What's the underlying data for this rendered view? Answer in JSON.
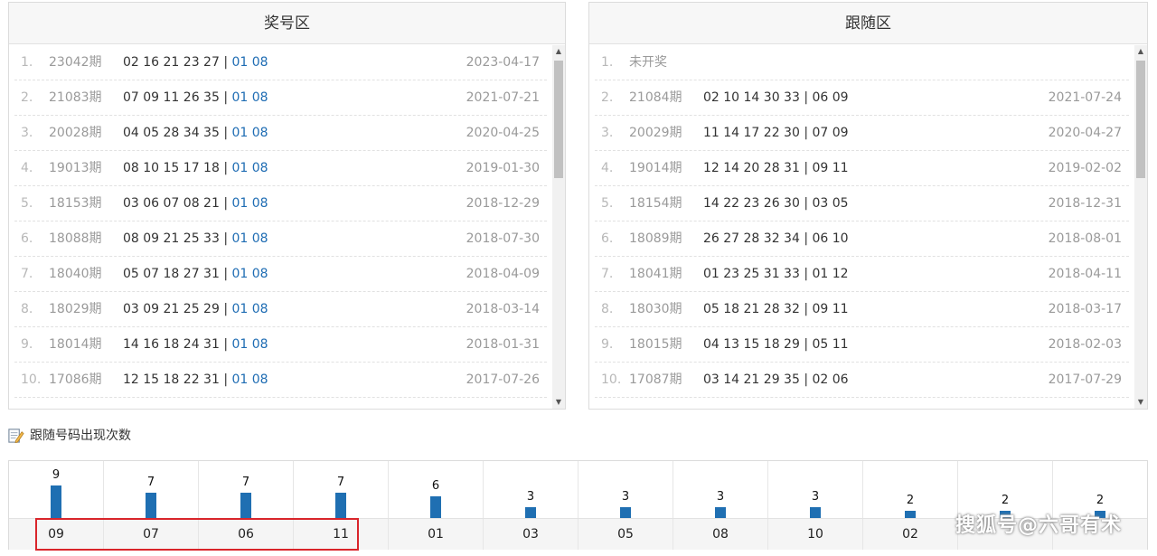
{
  "left_panel": {
    "title": "奖号区",
    "rows": [
      {
        "idx": "1.",
        "issue": "23042期",
        "front": "02 16 21 23 27 | ",
        "back": "01 08",
        "date": "2023-04-17"
      },
      {
        "idx": "2.",
        "issue": "21083期",
        "front": "07 09 11 26 35 | ",
        "back": "01 08",
        "date": "2021-07-21"
      },
      {
        "idx": "3.",
        "issue": "20028期",
        "front": "04 05 28 34 35 | ",
        "back": "01 08",
        "date": "2020-04-25"
      },
      {
        "idx": "4.",
        "issue": "19013期",
        "front": "08 10 15 17 18 | ",
        "back": "01 08",
        "date": "2019-01-30"
      },
      {
        "idx": "5.",
        "issue": "18153期",
        "front": "03 06 07 08 21 | ",
        "back": "01 08",
        "date": "2018-12-29"
      },
      {
        "idx": "6.",
        "issue": "18088期",
        "front": "08 09 21 25 33 | ",
        "back": "01 08",
        "date": "2018-07-30"
      },
      {
        "idx": "7.",
        "issue": "18040期",
        "front": "05 07 18 27 31 | ",
        "back": "01 08",
        "date": "2018-04-09"
      },
      {
        "idx": "8.",
        "issue": "18029期",
        "front": "03 09 21 25 29 | ",
        "back": "01 08",
        "date": "2018-03-14"
      },
      {
        "idx": "9.",
        "issue": "18014期",
        "front": "14 16 18 24 31 | ",
        "back": "01 08",
        "date": "2018-01-31"
      },
      {
        "idx": "10.",
        "issue": "17086期",
        "front": "12 15 18 22 31 | ",
        "back": "01 08",
        "date": "2017-07-26"
      }
    ]
  },
  "right_panel": {
    "title": "跟随区",
    "rows": [
      {
        "idx": "1.",
        "issue": "未开奖",
        "nums": "",
        "date": ""
      },
      {
        "idx": "2.",
        "issue": "21084期",
        "nums": "02 10 14 30 33 | 06 09",
        "date": "2021-07-24"
      },
      {
        "idx": "3.",
        "issue": "20029期",
        "nums": "11 14 17 22 30 | 07 09",
        "date": "2020-04-27"
      },
      {
        "idx": "4.",
        "issue": "19014期",
        "nums": "12 14 20 28 31 | 09 11",
        "date": "2019-02-02"
      },
      {
        "idx": "5.",
        "issue": "18154期",
        "nums": "14 22 23 26 30 | 03 05",
        "date": "2018-12-31"
      },
      {
        "idx": "6.",
        "issue": "18089期",
        "nums": "26 27 28 32 34 | 06 10",
        "date": "2018-08-01"
      },
      {
        "idx": "7.",
        "issue": "18041期",
        "nums": "01 23 25 31 33 | 01 12",
        "date": "2018-04-11"
      },
      {
        "idx": "8.",
        "issue": "18030期",
        "nums": "05 18 21 28 32 | 09 11",
        "date": "2018-03-17"
      },
      {
        "idx": "9.",
        "issue": "18015期",
        "nums": "04 13 15 18 29 | 05 11",
        "date": "2018-02-03"
      },
      {
        "idx": "10.",
        "issue": "17087期",
        "nums": "03 14 21 29 35 | 02 06",
        "date": "2017-07-29"
      }
    ]
  },
  "section": {
    "title": "跟随号码出现次数",
    "icon": "edit-note-icon"
  },
  "stats": {
    "items": [
      {
        "number": "09",
        "count": 9
      },
      {
        "number": "07",
        "count": 7
      },
      {
        "number": "06",
        "count": 7
      },
      {
        "number": "11",
        "count": 7
      },
      {
        "number": "01",
        "count": 6
      },
      {
        "number": "03",
        "count": 3
      },
      {
        "number": "05",
        "count": 3
      },
      {
        "number": "08",
        "count": 3
      },
      {
        "number": "10",
        "count": 3
      },
      {
        "number": "02",
        "count": 2
      },
      {
        "number": "",
        "count": 2
      },
      {
        "number": "",
        "count": 2
      }
    ],
    "highlighted": [
      "09",
      "07",
      "06",
      "11"
    ]
  },
  "watermark": "搜狐号@六哥有术",
  "colors": {
    "bar": "#1f6fb2",
    "back_number": "#1e6cb3",
    "highlight_border": "#d9252b"
  }
}
